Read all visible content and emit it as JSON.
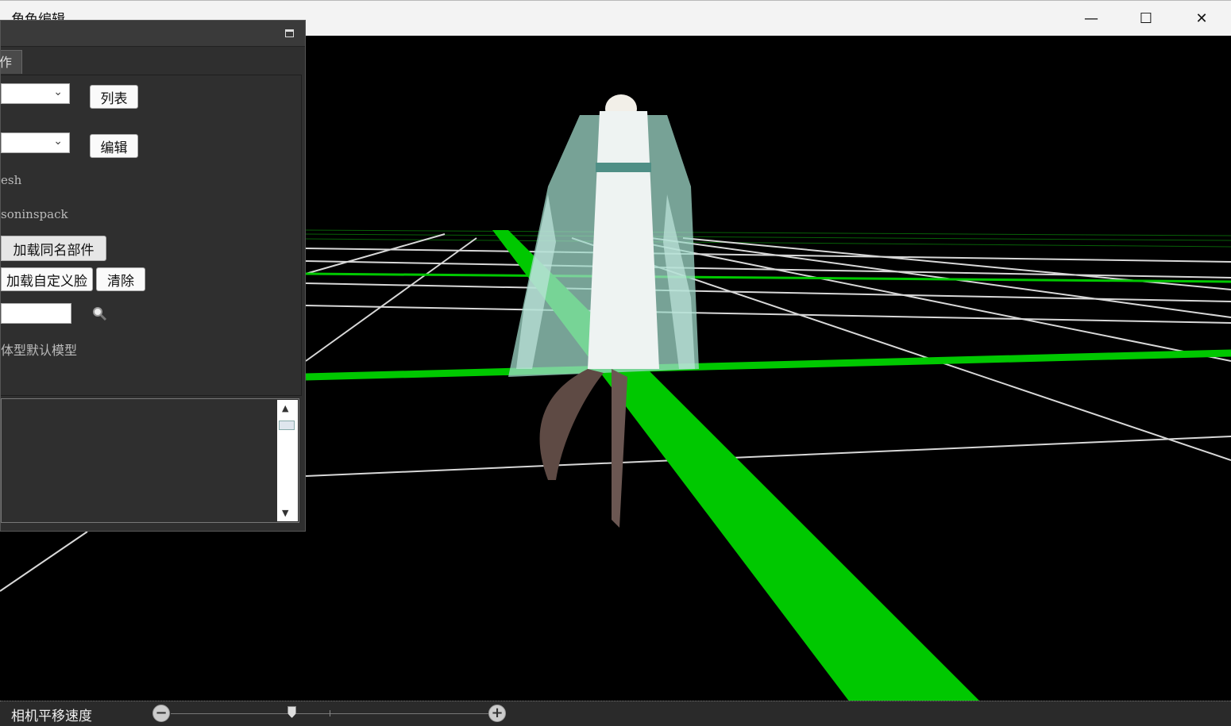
{
  "window": {
    "title": "角色编辑",
    "minimize_glyph": "—",
    "maximize_glyph": "☐",
    "close_glyph": "✕"
  },
  "panel": {
    "tab_label": "作",
    "combo1_button": "列表",
    "combo2_button": "编辑",
    "text_mesh": "esh",
    "text_pack": "soninspack",
    "load_same_name_button": "加载同名部件",
    "load_custom_face_button": "加载自定义脸",
    "clear_button": "清除",
    "default_model_label": "体型默认模型",
    "scroll_up_glyph": "▲",
    "scroll_down_glyph": "▼"
  },
  "bottom_bar": {
    "label": "相机平移速度",
    "minus_glyph": "−",
    "plus_glyph": "+",
    "slider_value": 0.38
  },
  "colors": {
    "grid_green": "#00c800",
    "grid_white": "#d8d8d8",
    "panel_bg": "#2f2f2f"
  }
}
